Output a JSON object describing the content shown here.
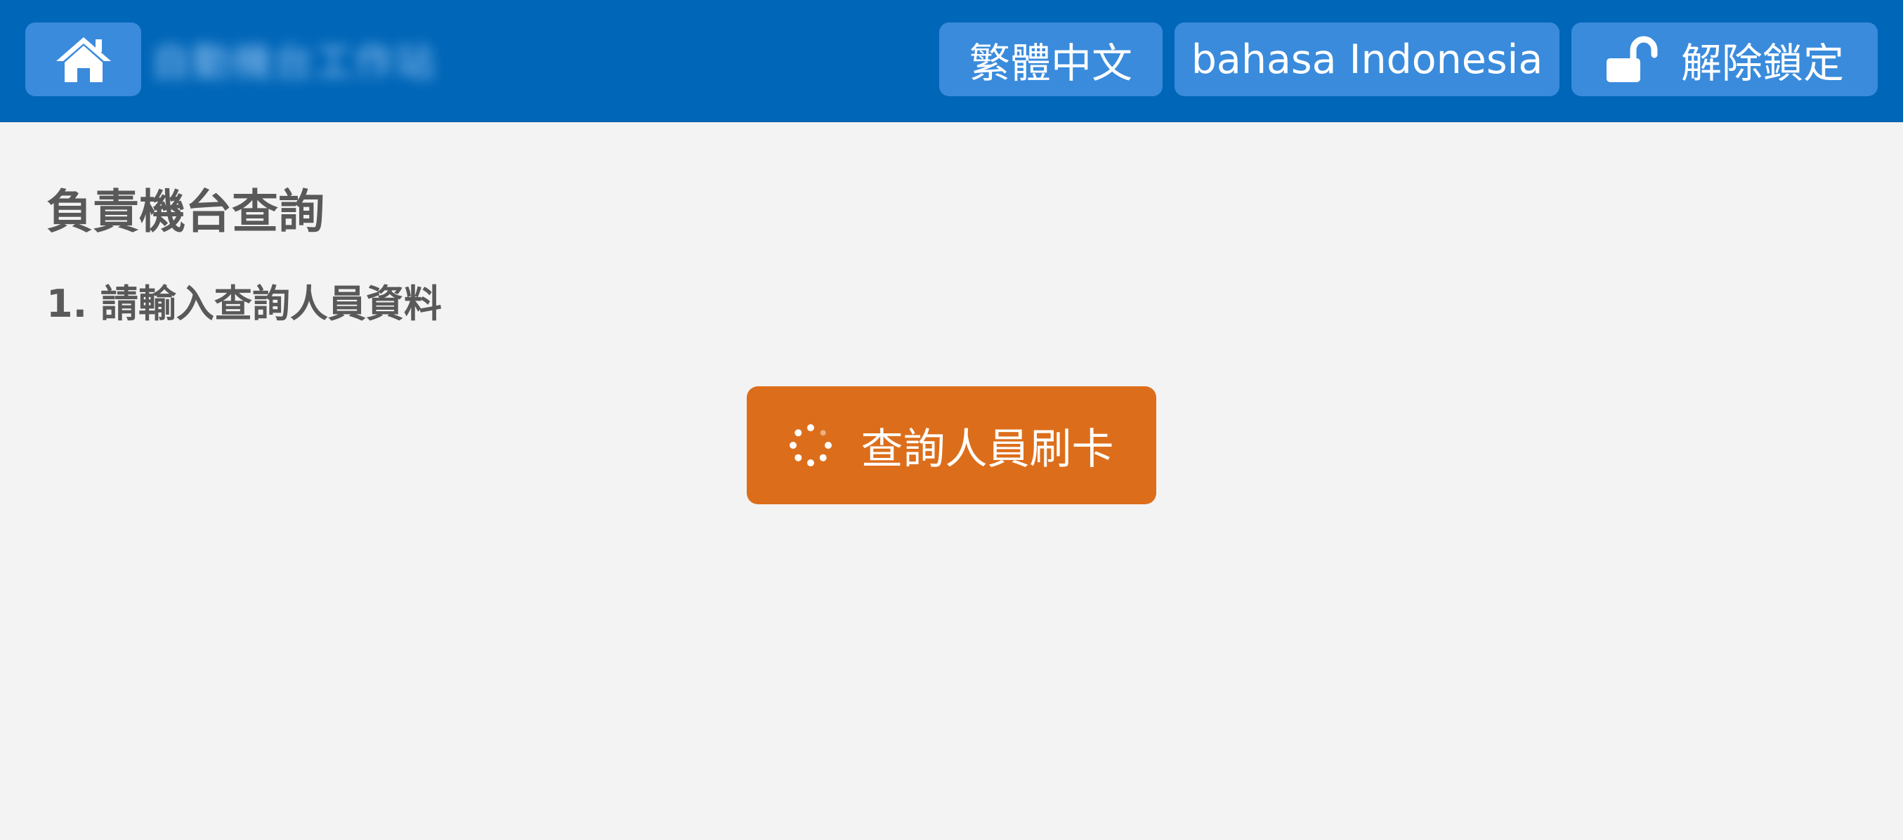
{
  "header": {
    "home_icon": "home-icon",
    "site_title": "自動機台工作站",
    "language_buttons": [
      {
        "label": "繁體中文"
      },
      {
        "label": "bahasa Indonesia"
      }
    ],
    "unlock": {
      "icon": "unlock-icon",
      "label": "解除鎖定"
    }
  },
  "main": {
    "title": "負責機台查詢",
    "step": "1. 請輸入查詢人員資料",
    "swipe_button": {
      "icon": "spinner-icon",
      "label": "查詢人員刷卡"
    }
  },
  "colors": {
    "header_bg": "#0066b8",
    "header_button_bg": "#3a8bdc",
    "page_bg": "#f4f3f4",
    "text": "#595959",
    "action_orange": "#dc6e1b"
  }
}
